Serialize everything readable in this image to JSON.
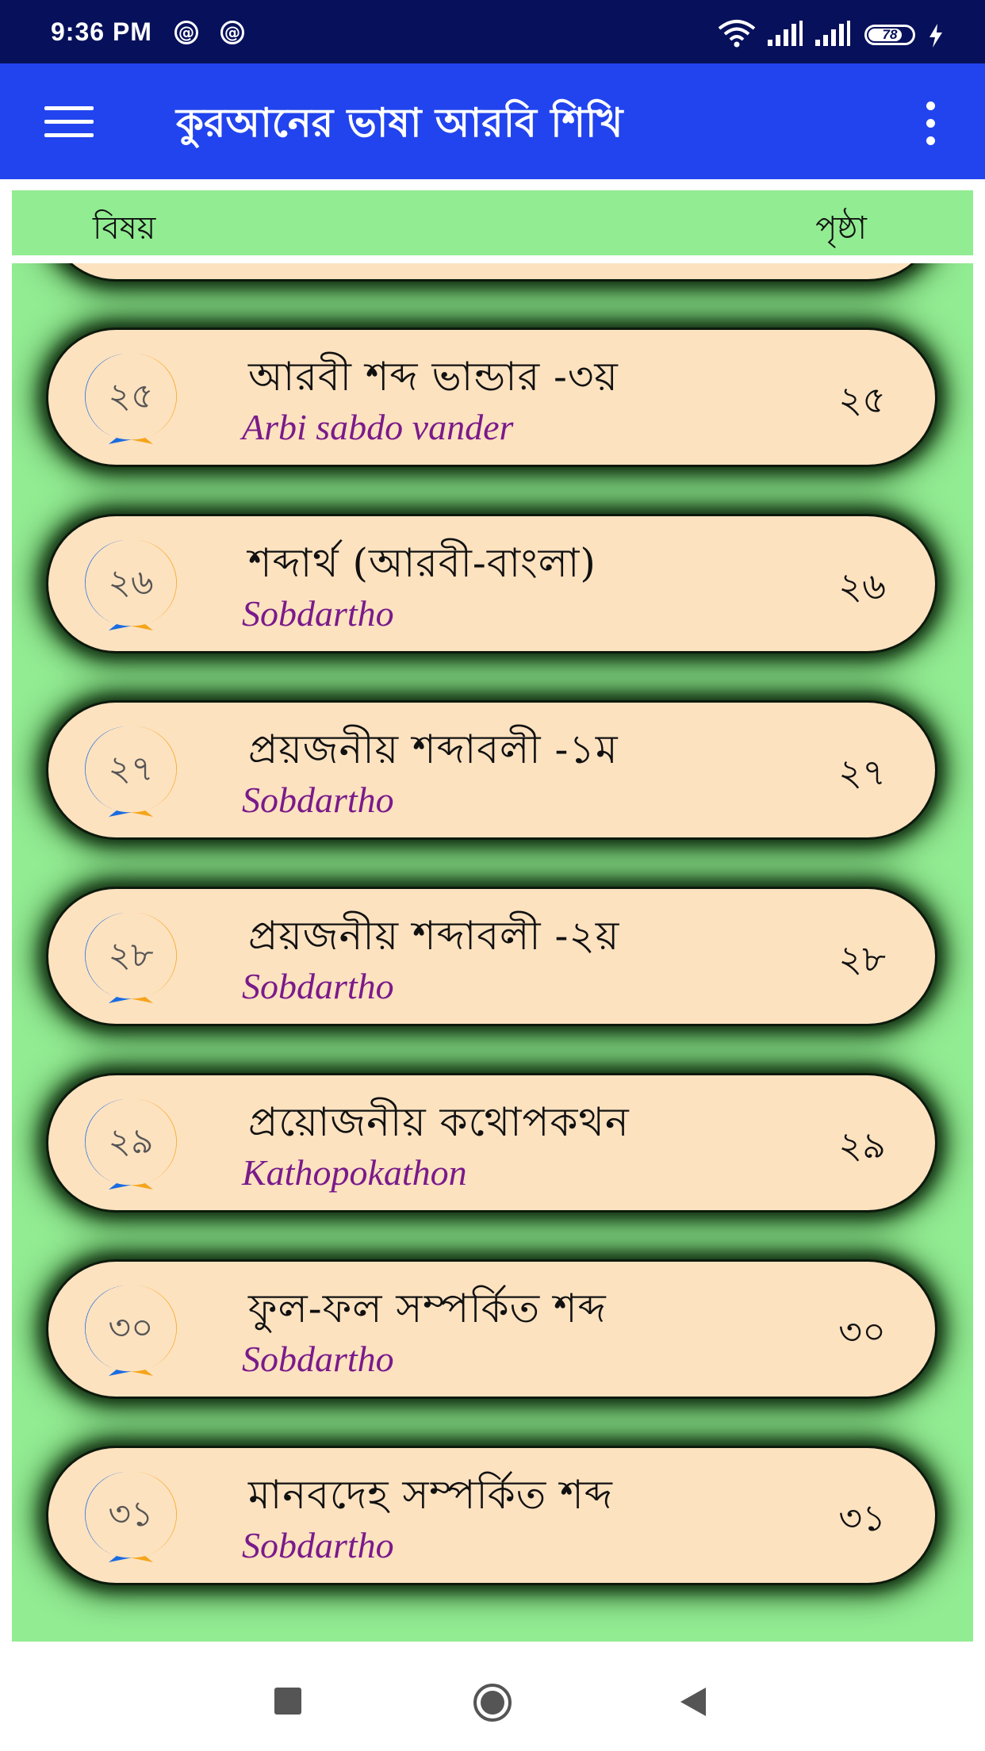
{
  "status_bar": {
    "time": "9:36 PM",
    "battery_level": "78",
    "battery_fraction": 0.78,
    "icons": [
      "at-icon",
      "at-icon",
      "wifi-icon",
      "signal-icon",
      "signal-icon",
      "battery-icon",
      "charging-bolt-icon"
    ]
  },
  "app_bar": {
    "title": "কুরআনের ভাষা আরবি শিখি",
    "menu_icon": "hamburger-menu-icon",
    "overflow_icon": "more-vertical-icon",
    "color": "#2244ee"
  },
  "header": {
    "subject_label": "বিষয়",
    "page_label": "পৃষ্ঠা"
  },
  "items": [
    {
      "number": "২৫",
      "title": "আরবী শব্দ ভান্ডার -৩য়",
      "subtitle": "Arbi sabdo vander",
      "page": "২৫"
    },
    {
      "number": "২৬",
      "title": "শব্দার্থ (আরবী-বাংলা)",
      "subtitle": "Sobdartho",
      "page": "২৬"
    },
    {
      "number": "২৭",
      "title": "প্রয়জনীয় শব্দাবলী -১ম",
      "subtitle": "Sobdartho",
      "page": "২৭"
    },
    {
      "number": "২৮",
      "title": "প্রয়জনীয় শব্দাবলী -২য়",
      "subtitle": "Sobdartho",
      "page": "২৮"
    },
    {
      "number": "২৯",
      "title": "প্রয়োজনীয় কথোপকথন",
      "subtitle": "Kathopokathon",
      "page": "২৯"
    },
    {
      "number": "৩০",
      "title": "ফুল-ফল সম্পর্কিত শব্দ",
      "subtitle": "Sobdartho",
      "page": "৩০"
    },
    {
      "number": "৩১",
      "title": "মানবদেহ সম্পর্কিত শব্দ",
      "subtitle": "Sobdartho",
      "page": "৩১"
    }
  ],
  "colors": {
    "list_background": "#92ec92",
    "item_background": "#fde2c0",
    "subtitle": "#7a1a8a",
    "status_bar": "#07105a"
  },
  "nav_bar": {
    "icons": [
      "recents-square-icon",
      "home-circle-icon",
      "back-triangle-icon"
    ]
  }
}
